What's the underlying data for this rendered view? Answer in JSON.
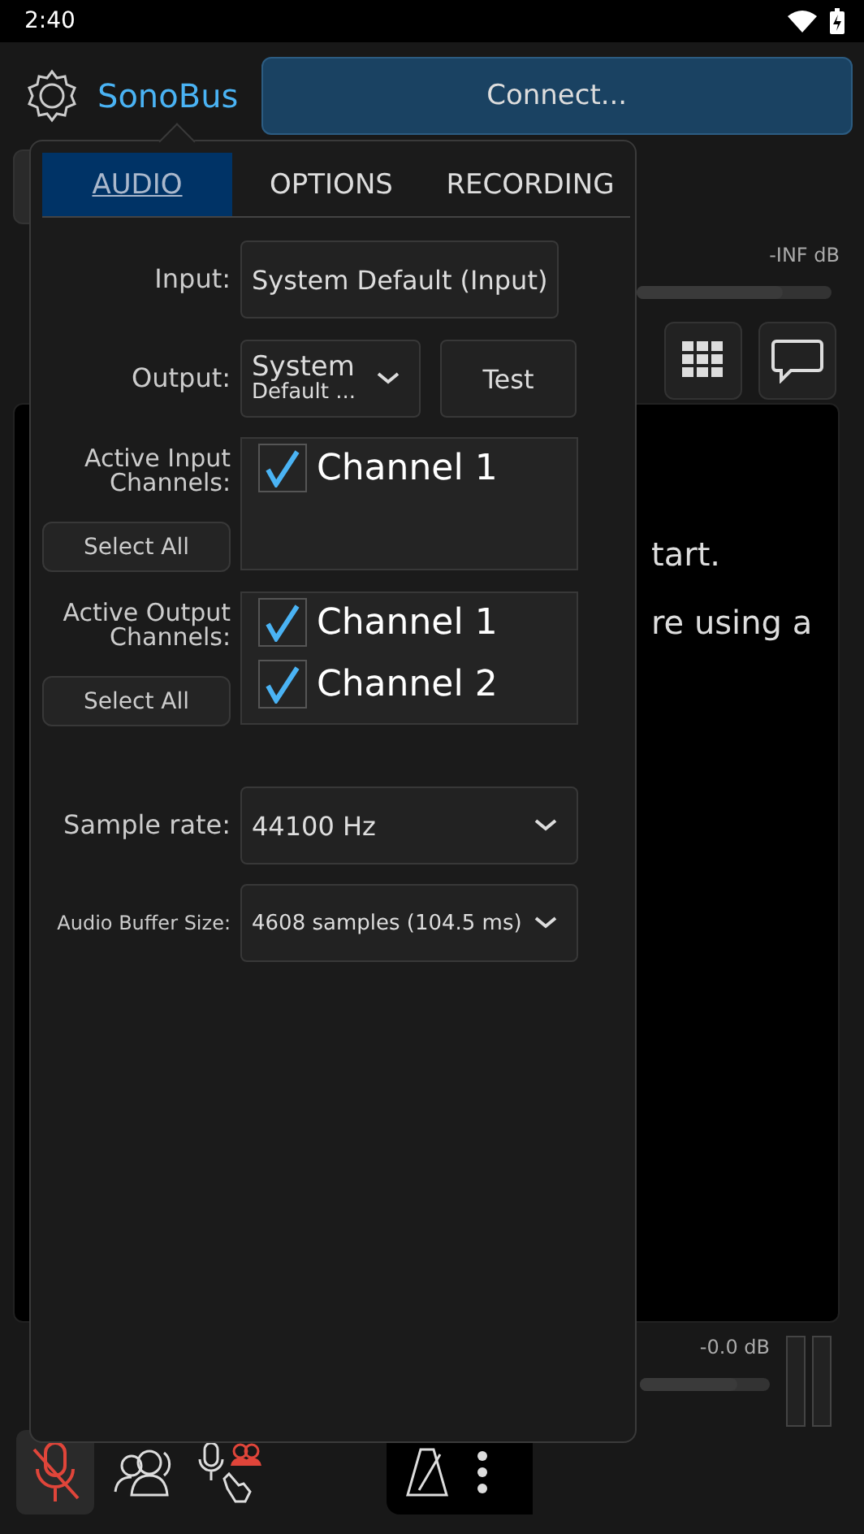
{
  "status_bar": {
    "time": "2:40"
  },
  "header": {
    "app_name": "SonoBus",
    "connect_button": "Connect..."
  },
  "background": {
    "input_meter_reading": "-INF dB",
    "input_gain": {
      "level": 0.75
    },
    "message_lines": [
      "tart.",
      "re using a"
    ],
    "output_meter_reading": "-0.0 dB",
    "output_gain": {
      "level": 0.75
    }
  },
  "settings_popup": {
    "tabs": [
      {
        "label": "AUDIO",
        "selected": true
      },
      {
        "label": "OPTIONS",
        "selected": false
      },
      {
        "label": "RECORDING",
        "selected": false
      }
    ],
    "input": {
      "label": "Input:",
      "value": "System Default (Input)"
    },
    "output": {
      "label": "Output:",
      "value_line_1": "System",
      "value_line_2": "Default ...",
      "test_button": "Test"
    },
    "active_input_channels": {
      "label": "Active Input Channels:",
      "select_all_button": "Select All",
      "channels": [
        {
          "label": "Channel 1",
          "checked": true
        }
      ]
    },
    "active_output_channels": {
      "label": "Active Output Channels:",
      "select_all_button": "Select All",
      "channels": [
        {
          "label": "Channel 1",
          "checked": true
        },
        {
          "label": "Channel 2",
          "checked": true
        }
      ]
    },
    "sample_rate": {
      "label": "Sample rate:",
      "value": "44100 Hz"
    },
    "buffer_size": {
      "label": "Audio Buffer Size:",
      "value": "4608 samples (104.5 ms)"
    }
  },
  "bottom_bar": {
    "mic_muted": true
  }
}
